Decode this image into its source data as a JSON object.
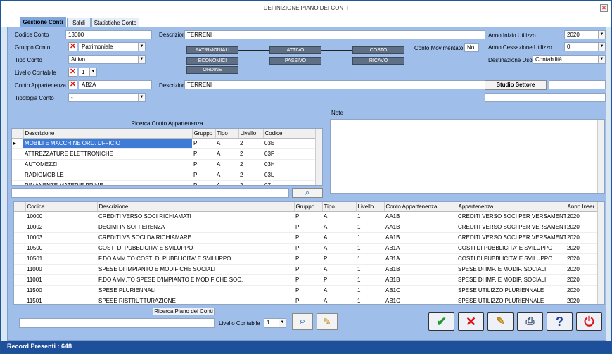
{
  "window": {
    "title": "DEFINIZIONE PIANO DEI CONTI"
  },
  "tabs": [
    "Gestione Conti",
    "Saldi",
    "Statistiche Conto"
  ],
  "form": {
    "codice_conto_label": "Codice Conto",
    "codice_conto_value": "13000",
    "descrizione_label": "Descrizione",
    "descrizione_value": "TERRENI",
    "gruppo_conto_label": "Gruppo Conto",
    "gruppo_conto_value": "Patrimoniale",
    "tipo_conto_label": "Tipo Conto",
    "tipo_conto_value": "Attivo",
    "livello_contabile_label": "Livello Contabile",
    "livello_contabile_value": "1",
    "conto_appartenenza_label": "Conto Appartenenza",
    "conto_appartenenza_value": "AB2A",
    "descrizione2_label": "Descrizione",
    "descrizione2_value": "TERRENI",
    "tipologia_conto_label": "Tipologia Conto",
    "tipologia_conto_value": "-",
    "conto_movimentato_label": "Conto Movimentato",
    "conto_movimentato_value": "No",
    "anno_inizio_label": "Anno Inizio Utilizzo",
    "anno_inizio_value": "2020",
    "anno_cessazione_label": "Anno Cessazione Utilizzo",
    "anno_cessazione_value": "0",
    "destinazione_uso_label": "Destinazione Uso",
    "destinazione_uso_value": "Contabilità",
    "studio_settore_label": "Studio Settore"
  },
  "flow": {
    "patrimoniali": "PATRIMONIALI",
    "economici": "ECONOMICI",
    "ordine": "ORDINE",
    "attivo": "ATTIVO",
    "passivo": "PASSIVO",
    "costo": "COSTO",
    "ricavo": "RICAVO"
  },
  "ricerca": {
    "title": "Ricerca Conto Appartenenza",
    "columns": [
      "Descrizione",
      "Gruppo",
      "Tipo",
      "Livello",
      "Codice"
    ],
    "rows": [
      [
        "MOBILI E MACCHINE ORD. UFFICIO",
        "P",
        "A",
        "2",
        "03E"
      ],
      [
        "ATTREZZATURE ELETTRONICHE",
        "P",
        "A",
        "2",
        "03F"
      ],
      [
        "AUTOMEZZI",
        "P",
        "A",
        "2",
        "03H"
      ],
      [
        "RADIOMOBILE",
        "P",
        "A",
        "2",
        "03L"
      ],
      [
        "RIMANENZE MATERIE PRIME",
        "P",
        "A",
        "2",
        "07"
      ]
    ]
  },
  "note": {
    "title": "Note"
  },
  "main_grid": {
    "columns": [
      "Codice",
      "Descrizione",
      "Gruppo",
      "Tipo",
      "Livello",
      "Conto Appartenenza",
      "Appartenenza",
      "Anno Inser."
    ],
    "rows": [
      [
        "10000",
        "CREDITI VERSO SOCI RICHIAMATI",
        "P",
        "A",
        "1",
        "AA1B",
        "CREDITI VERSO SOCI PER VERSAMENTI ...",
        "2020"
      ],
      [
        "10002",
        "DECIMI IN SOFFERENZA",
        "P",
        "A",
        "1",
        "AA1B",
        "CREDITI VERSO SOCI PER VERSAMENTI ...",
        "2020"
      ],
      [
        "10003",
        "CREDITI VS SOCI DA RICHIAMARE",
        "P",
        "A",
        "1",
        "AA1B",
        "CREDITI VERSO SOCI PER VERSAMENTI ...",
        "2020"
      ],
      [
        "10500",
        "COSTI DI PUBBLICITA' E SVILUPPO",
        "P",
        "A",
        "1",
        "AB1A",
        "COSTI DI PUBBLICITA' E SVILUPPO",
        "2020"
      ],
      [
        "10501",
        "F.DO AMM.TO COSTI DI PUBBLICITA' E SVILUPPO",
        "P",
        "P",
        "1",
        "AB1A",
        "COSTI DI PUBBLICITA' E SVILUPPO",
        "2020"
      ],
      [
        "11000",
        "SPESE DI IMPIANTO E MODIFICHE SOCIALI",
        "P",
        "A",
        "1",
        "AB1B",
        "SPESE DI IMP. E MODIF. SOCIALI",
        "2020"
      ],
      [
        "11001",
        "F.DO AMM.TO SPESE D'IMPIANTO E MODIFICHE SOC.",
        "P",
        "P",
        "1",
        "AB1B",
        "SPESE DI IMP. E MODIF. SOCIALI",
        "2020"
      ],
      [
        "11500",
        "SPESE PLURIENNALI",
        "P",
        "A",
        "1",
        "AB1C",
        "SPESE UTILIZZO PLURIENNALE",
        "2020"
      ],
      [
        "11501",
        "SPESE RISTRUTTURAZIONE",
        "P",
        "A",
        "1",
        "AB1C",
        "SPESE UTILIZZO PLURIENNALE",
        "2020"
      ]
    ]
  },
  "bottom": {
    "ricerca_piano_label": "Ricerca Piano dei Conti",
    "livello_label": "Livello Contabile",
    "livello_value": "1"
  },
  "status": {
    "record_text": "Record Presenti : 648"
  }
}
